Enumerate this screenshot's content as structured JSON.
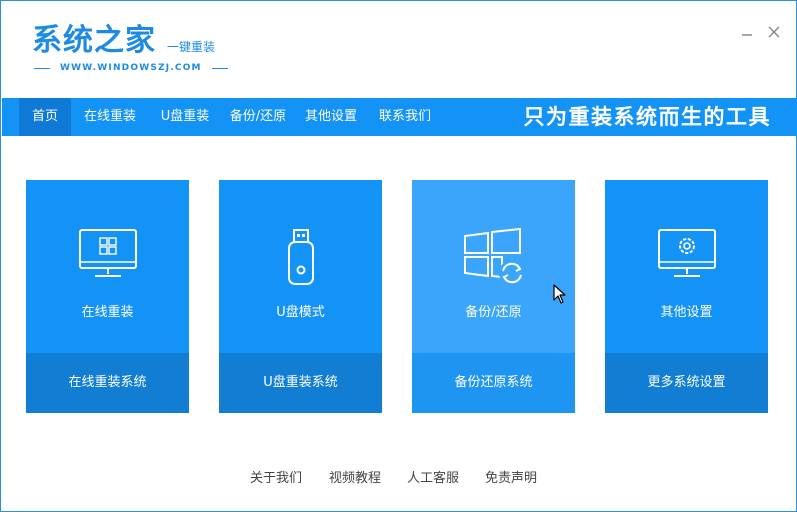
{
  "header": {
    "logo_title": "系统之家",
    "logo_sub": "一键重装",
    "logo_url": "WWW.WINDOWSZJ.COM",
    "minimize_icon": "minimize-icon",
    "close_icon": "close-icon"
  },
  "nav": {
    "items": [
      "首页",
      "在线重装",
      "U盘重装",
      "备份/还原",
      "其他设置",
      "联系我们"
    ],
    "active_index": 0,
    "slogan": "只为重装系统而生的工具"
  },
  "cards": [
    {
      "title": "在线重装",
      "bottom": "在线重装系统",
      "icon": "monitor-windows-icon"
    },
    {
      "title": "U盘模式",
      "bottom": "U盘重装系统",
      "icon": "usb-drive-icon"
    },
    {
      "title": "备份/还原",
      "bottom": "备份还原系统",
      "icon": "windows-restore-icon"
    },
    {
      "title": "其他设置",
      "bottom": "更多系统设置",
      "icon": "monitor-gear-icon"
    }
  ],
  "footer": {
    "links": [
      "关于我们",
      "视频教程",
      "人工客服",
      "免责声明"
    ]
  },
  "colors": {
    "brand": "#1493f6",
    "card_bottom": "#127ed3",
    "card_hover": "#3aa5fa",
    "nav_active": "#0f79d6"
  }
}
